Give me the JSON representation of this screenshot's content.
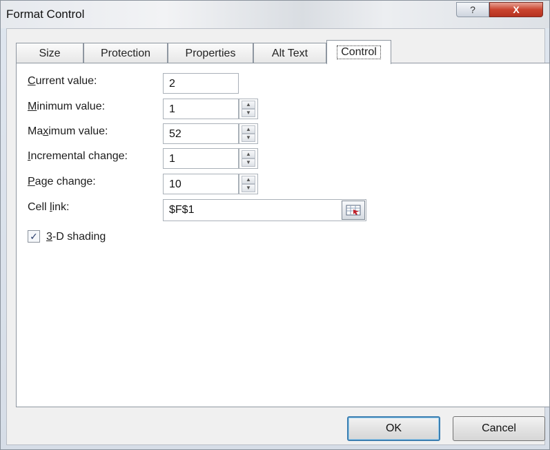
{
  "window": {
    "title": "Format Control",
    "help_label": "?",
    "close_label": "X"
  },
  "tabs": [
    {
      "label": "Size"
    },
    {
      "label": "Protection"
    },
    {
      "label": "Properties"
    },
    {
      "label": "Alt Text"
    },
    {
      "label": "Control",
      "active": true
    }
  ],
  "fields": {
    "current_value": {
      "label_pre": "",
      "label_key": "C",
      "label_post": "urrent value:",
      "value": "2"
    },
    "minimum_value": {
      "label_pre": "",
      "label_key": "M",
      "label_post": "inimum value:",
      "value": "1"
    },
    "maximum_value": {
      "label_pre": "Ma",
      "label_key": "x",
      "label_post": "imum value:",
      "value": "52"
    },
    "incremental_change": {
      "label_pre": "",
      "label_key": "I",
      "label_post": "ncremental change:",
      "value": "1"
    },
    "page_change": {
      "label_pre": "",
      "label_key": "P",
      "label_post": "age change:",
      "value": "10"
    },
    "cell_link": {
      "label_pre": "Cell ",
      "label_key": "l",
      "label_post": "ink:",
      "value": "$F$1"
    }
  },
  "shading": {
    "checked": true,
    "check_glyph": "✓",
    "label_pre": "",
    "label_key": "3",
    "label_post": "-D shading"
  },
  "buttons": {
    "ok": "OK",
    "cancel": "Cancel"
  },
  "icons": {
    "spin": "spin-arrows-icon",
    "ref": "collapse-dialog-icon"
  }
}
